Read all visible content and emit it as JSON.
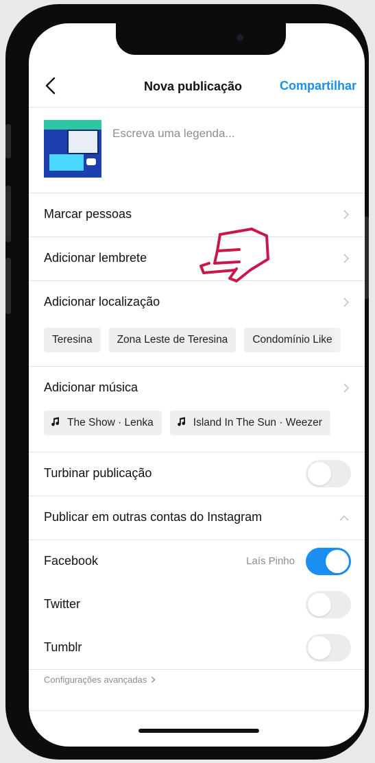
{
  "header": {
    "title": "Nova publicação",
    "share_label": "Compartilhar"
  },
  "caption": {
    "placeholder": "Escreva uma legenda..."
  },
  "rows": {
    "tag_people": "Marcar pessoas",
    "add_reminder": "Adicionar lembrete",
    "add_location": "Adicionar localização",
    "add_music": "Adicionar música",
    "boost_post": "Turbinar publicação",
    "share_other_accounts": "Publicar em outras contas do Instagram"
  },
  "location_suggestions": [
    "Teresina",
    "Zona Leste de Teresina",
    "Condomínio Like"
  ],
  "music_suggestions": [
    "The Show · Lenka",
    "Island In The Sun · Weezer"
  ],
  "accounts": {
    "facebook": {
      "label": "Facebook",
      "account_name": "Laís Pinho",
      "enabled": true
    },
    "twitter": {
      "label": "Twitter",
      "enabled": false
    },
    "tumblr": {
      "label": "Tumblr",
      "enabled": false
    }
  },
  "boost_enabled": false,
  "advanced_settings": "Configurações avançadas",
  "colors": {
    "accent": "#1a8ff1",
    "annotation": "#c8184a"
  },
  "icons": [
    "back-arrow-icon",
    "chevron-right-icon",
    "chevron-up-icon",
    "music-note-icon",
    "pointing-hand-icon"
  ]
}
